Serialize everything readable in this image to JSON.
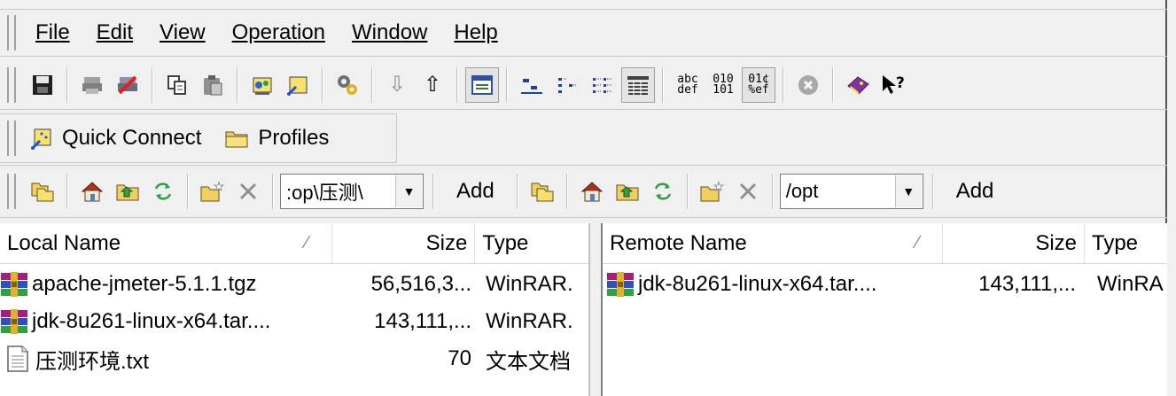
{
  "menu": [
    "File",
    "Edit",
    "View",
    "Operation",
    "Window",
    "Help"
  ],
  "quick_connect": {
    "label": "Quick Connect",
    "profiles_label": "Profiles"
  },
  "navigation": {
    "local_path": ":op\\压测\\",
    "remote_path": "/opt",
    "local_add": "Add",
    "remote_add": "Add"
  },
  "local": {
    "columns": [
      "Local Name",
      "Size",
      "Type"
    ],
    "files": [
      {
        "name": "apache-jmeter-5.1.1.tgz",
        "size": "56,516,3...",
        "type": "WinRAR."
      },
      {
        "name": "jdk-8u261-linux-x64.tar....",
        "size": "143,111,...",
        "type": "WinRAR."
      },
      {
        "name": "压测环境.txt",
        "size": "70",
        "type": "文本文档"
      }
    ]
  },
  "remote": {
    "columns": [
      "Remote Name",
      "Size",
      "Type"
    ],
    "files": [
      {
        "name": "jdk-8u261-linux-x64.tar....",
        "size": "143,111,...",
        "type": "WinRA"
      }
    ]
  },
  "icons": {
    "text_mode": "abc\ndef",
    "binary_mode": "010\n101",
    "auto_mode": "01¢\n%ef"
  }
}
